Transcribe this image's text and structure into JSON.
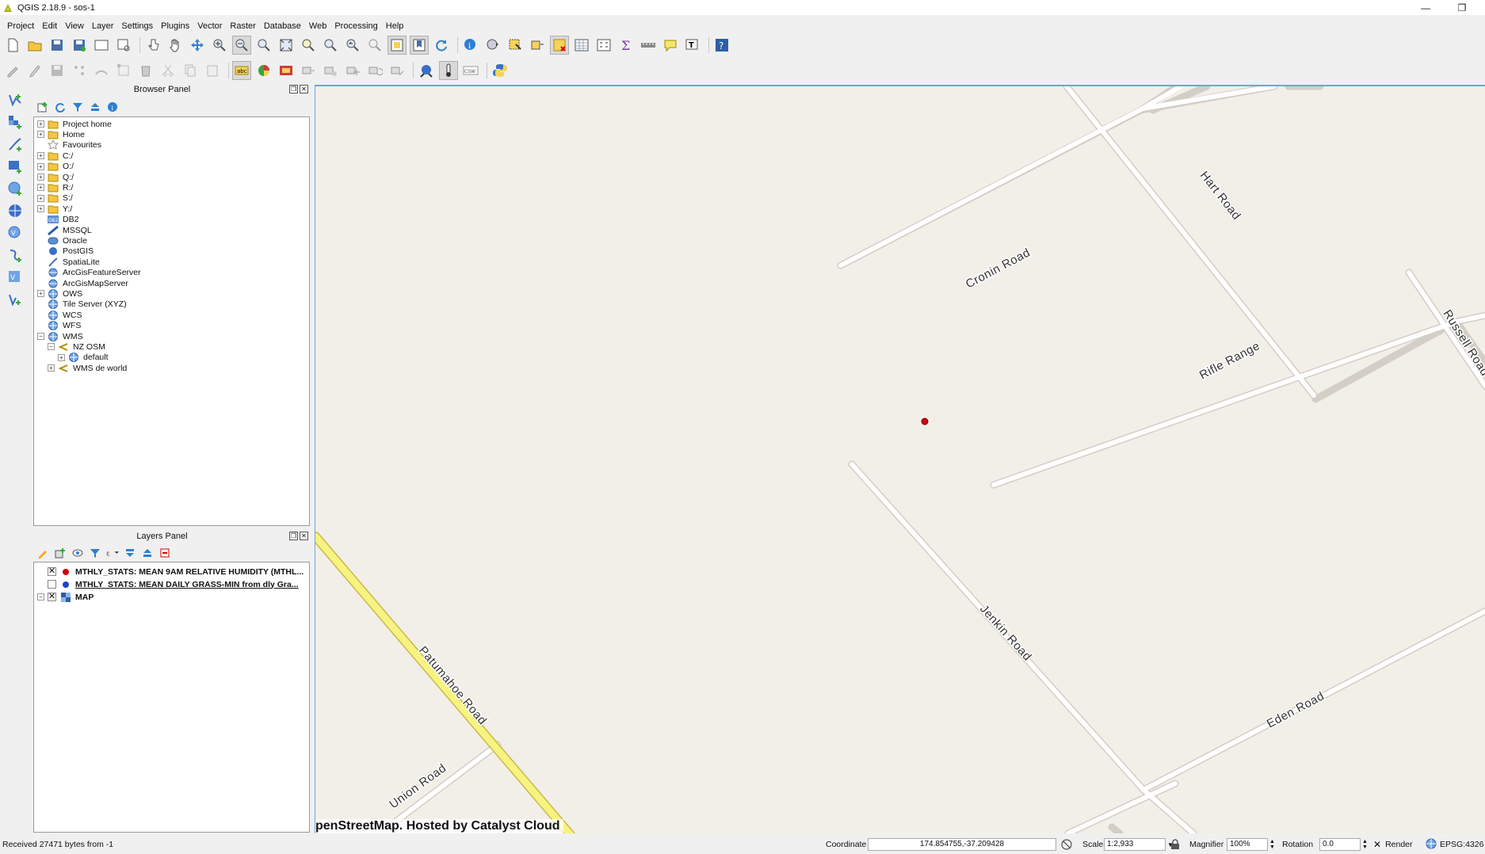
{
  "window": {
    "title": "QGIS 2.18.9 - sos-1",
    "minimize": "—",
    "restore": "❐"
  },
  "menu": [
    "Project",
    "Edit",
    "View",
    "Layer",
    "Settings",
    "Plugins",
    "Vector",
    "Raster",
    "Database",
    "Web",
    "Processing",
    "Help"
  ],
  "browser_panel": {
    "title": "Browser Panel",
    "items": [
      {
        "label": "Project home",
        "icon": "folder-icon",
        "expander": "+",
        "level": 0
      },
      {
        "label": "Home",
        "icon": "folder-icon",
        "expander": "+",
        "level": 0
      },
      {
        "label": "Favourites",
        "icon": "star-icon",
        "expander": "",
        "level": 0
      },
      {
        "label": "C:/",
        "icon": "folder-icon",
        "expander": "+",
        "level": 0
      },
      {
        "label": "O:/",
        "icon": "folder-icon",
        "expander": "+",
        "level": 0
      },
      {
        "label": "Q:/",
        "icon": "folder-icon",
        "expander": "+",
        "level": 0
      },
      {
        "label": "R:/",
        "icon": "folder-icon",
        "expander": "+",
        "level": 0
      },
      {
        "label": "S:/",
        "icon": "folder-icon",
        "expander": "+",
        "level": 0
      },
      {
        "label": "Y:/",
        "icon": "folder-icon",
        "expander": "+",
        "level": 0
      },
      {
        "label": "DB2",
        "icon": "db2-icon",
        "expander": "",
        "level": 0
      },
      {
        "label": "MSSQL",
        "icon": "mssql-icon",
        "expander": "",
        "level": 0
      },
      {
        "label": "Oracle",
        "icon": "oracle-icon",
        "expander": "",
        "level": 0
      },
      {
        "label": "PostGIS",
        "icon": "postgis-icon",
        "expander": "",
        "level": 0
      },
      {
        "label": "SpatiaLite",
        "icon": "spatialite-icon",
        "expander": "",
        "level": 0
      },
      {
        "label": "ArcGisFeatureServer",
        "icon": "arcgis-icon",
        "expander": "",
        "level": 0
      },
      {
        "label": "ArcGisMapServer",
        "icon": "arcgis-icon",
        "expander": "",
        "level": 0
      },
      {
        "label": "OWS",
        "icon": "globe-icon",
        "expander": "+",
        "level": 0
      },
      {
        "label": "Tile Server (XYZ)",
        "icon": "globe-icon",
        "expander": "",
        "level": 0
      },
      {
        "label": "WCS",
        "icon": "globe-icon",
        "expander": "",
        "level": 0
      },
      {
        "label": "WFS",
        "icon": "globe-icon",
        "expander": "",
        "level": 0
      },
      {
        "label": "WMS",
        "icon": "globe-icon",
        "expander": "−",
        "level": 0
      },
      {
        "label": "NZ OSM",
        "icon": "connection-icon",
        "expander": "−",
        "level": 1
      },
      {
        "label": "default",
        "icon": "globe-icon",
        "expander": "+",
        "level": 2
      },
      {
        "label": "WMS de world",
        "icon": "connection-icon",
        "expander": "+",
        "level": 1
      }
    ]
  },
  "layers_panel": {
    "title": "Layers Panel",
    "layers": [
      {
        "label": "MTHLY_STATS: MEAN 9AM RELATIVE HUMIDITY (MTHL...",
        "checked": true,
        "color": "#d40000",
        "underline": false
      },
      {
        "label": "MTHLY_STATS: MEAN DAILY GRASS-MIN from dly Gra...",
        "checked": false,
        "color": "#1f3fd6",
        "underline": true
      },
      {
        "label": "MAP",
        "checked": true,
        "color": "",
        "underline": false
      }
    ]
  },
  "map": {
    "attribution": "penStreetMap. Hosted by Catalyst Cloud",
    "roads": [
      "Cronin Road",
      "Hart Road",
      "Russell Road",
      "Rifle Range",
      "Jenkin Road",
      "Eden Road",
      "Patumahoe Road",
      "Union Road"
    ],
    "background_color": "#f2efe9",
    "point_color": "#d40000"
  },
  "status": {
    "message": "Received 27471 bytes from -1",
    "coordinate_label": "Coordinate",
    "coordinate": "174.854755,-37.209428",
    "scale_label": "Scale",
    "scale": "1:2,933",
    "magnifier_label": "Magnifier",
    "magnifier": "100%",
    "rotation_label": "Rotation",
    "rotation": "0.0",
    "render_label": "Render",
    "crs": "EPSG:4326"
  }
}
